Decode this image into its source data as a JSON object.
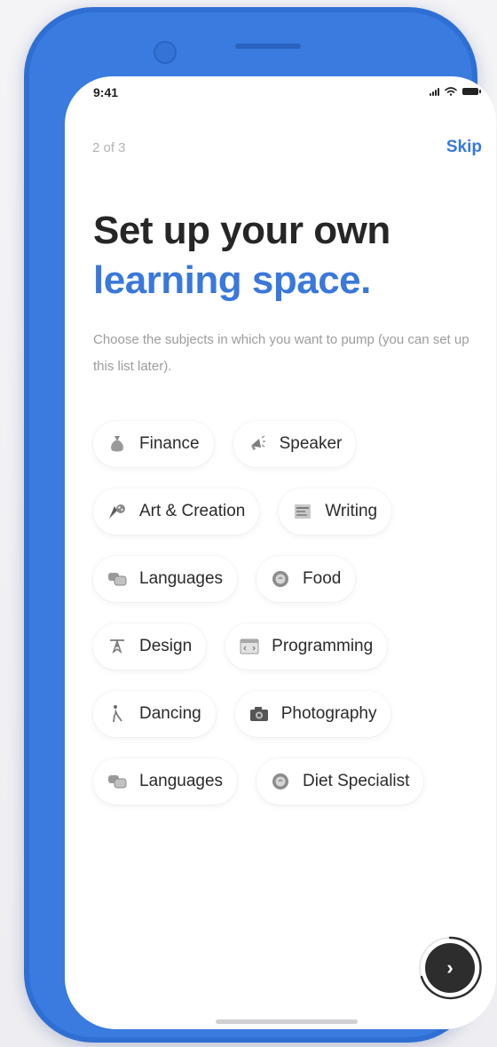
{
  "status_bar": {
    "time": "9:41"
  },
  "header": {
    "progress": "2 of 3",
    "skip_label": "Skip"
  },
  "headline": {
    "line1": "Set up your own",
    "line2": "learning space."
  },
  "subtitle": "Choose the subjects in which you want to pump (you can set up this list later).",
  "subjects": [
    {
      "label": "Finance",
      "icon": "money-bag-icon"
    },
    {
      "label": "Speaker",
      "icon": "megaphone-icon"
    },
    {
      "label": "Art & Creation",
      "icon": "art-icon"
    },
    {
      "label": "Writing",
      "icon": "writing-icon"
    },
    {
      "label": "Languages",
      "icon": "speech-bubbles-icon"
    },
    {
      "label": "Food",
      "icon": "food-icon"
    },
    {
      "label": "Design",
      "icon": "design-icon"
    },
    {
      "label": "Programming",
      "icon": "code-window-icon"
    },
    {
      "label": "Dancing",
      "icon": "dancer-icon"
    },
    {
      "label": "Photography",
      "icon": "camera-icon"
    },
    {
      "label": "Languages",
      "icon": "speech-bubbles-icon"
    },
    {
      "label": "Diet Specialist",
      "icon": "food-icon"
    }
  ],
  "next_button": {
    "icon": "chevron-right-icon",
    "glyph": "›"
  },
  "colors": {
    "accent": "#3a78dc",
    "phone_frame": "#2f6fd3",
    "next_button": "#2d2d2d"
  }
}
